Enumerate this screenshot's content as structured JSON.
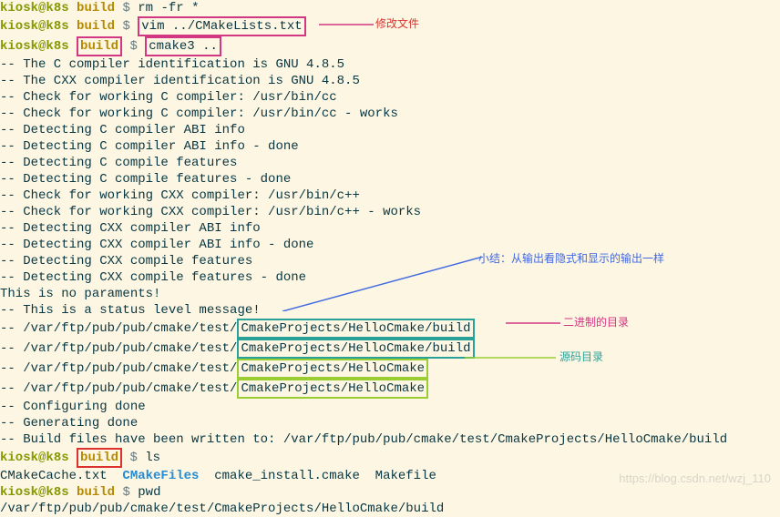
{
  "prompt": {
    "user": "kiosk",
    "host": "k8s",
    "path": "build",
    "dollar": "$"
  },
  "cmds": {
    "rm": "rm -fr *",
    "vim": "vim ../CMakeLists.txt",
    "cmake": "cmake3 ..",
    "ls": "ls",
    "pwd": "pwd"
  },
  "output": {
    "l1": "-- The C compiler identification is GNU 4.8.5",
    "l2": "-- The CXX compiler identification is GNU 4.8.5",
    "l3": "-- Check for working C compiler: /usr/bin/cc",
    "l4": "-- Check for working C compiler: /usr/bin/cc - works",
    "l5": "-- Detecting C compiler ABI info",
    "l6": "-- Detecting C compiler ABI info - done",
    "l7": "-- Detecting C compile features",
    "l8": "-- Detecting C compile features - done",
    "l9": "-- Check for working CXX compiler: /usr/bin/c++",
    "l10": "-- Check for working CXX compiler: /usr/bin/c++ - works",
    "l11": "-- Detecting CXX compiler ABI info",
    "l12": "-- Detecting CXX compiler ABI info - done",
    "l13": "-- Detecting CXX compile features",
    "l14": "-- Detecting CXX compile features - done",
    "l15": "This is no paraments!",
    "l16": "-- This is a status level message!",
    "path_prefix": "-- /var/ftp/pub/pub/cmake/test/",
    "bin_tail": "CmakeProjects/HelloCmake/build",
    "src_tail": "CmakeProjects/HelloCmake",
    "l21": "-- Configuring done",
    "l22": "-- Generating done",
    "l23": "-- Build files have been written to: /var/ftp/pub/pub/cmake/test/CmakeProjects/HelloCmake/build",
    "ls_txt": "CMakeCache.txt  ",
    "ls_dir": "CMakeFiles",
    "ls_rest": "  cmake_install.cmake  Makefile",
    "pwd_out": "/var/ftp/pub/pub/cmake/test/CmakeProjects/HelloCmake/build"
  },
  "annotations": {
    "modify_file": "修改文件",
    "summary": "小结：从输出看隐式和显示的输出一样",
    "binary_dir": "二进制的目录",
    "source_dir": "源码目录"
  },
  "watermark": "https://blog.csdn.net/wzj_110"
}
